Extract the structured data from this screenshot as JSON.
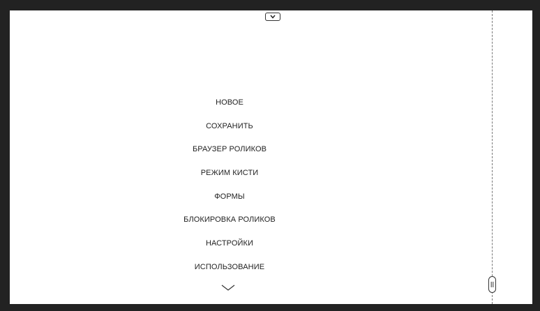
{
  "menu": {
    "items": [
      {
        "label": "НОВОЕ"
      },
      {
        "label": "СОХРАНИТЬ"
      },
      {
        "label": "БРАУЗЕР РОЛИКОВ"
      },
      {
        "label": "РЕЖИМ КИСТИ"
      },
      {
        "label": "ФОРМЫ"
      },
      {
        "label": "БЛОКИРОВКА РОЛИКОВ"
      },
      {
        "label": "НАСТРОЙКИ"
      },
      {
        "label": "ИСПОЛЬЗОВАНИЕ"
      }
    ]
  },
  "icons": {
    "top_toggle": "chevron-down-icon",
    "more": "chevron-down-icon",
    "handle": "drag-handle-icon"
  },
  "colors": {
    "frame": "#222222",
    "canvas": "#ffffff",
    "text": "#222222",
    "divider": "#777777"
  }
}
